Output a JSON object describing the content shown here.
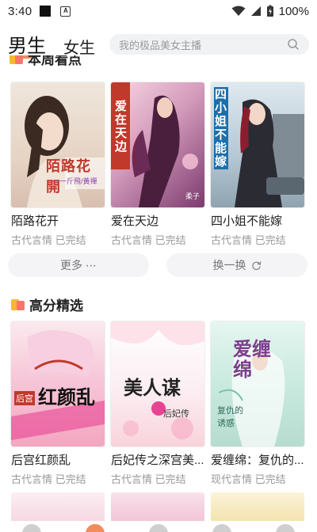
{
  "status_bar": {
    "time": "3:40",
    "battery": "100%"
  },
  "header": {
    "tab_male": "男生",
    "tab_female": "女生",
    "search_placeholder": "我的极品美女主播"
  },
  "section_weekly": {
    "title": "本周看点",
    "books": [
      {
        "title": "陌路花开",
        "meta": "古代言情 已完结",
        "cover_text": "陌路花開",
        "cover_sub": "一一斤飛/黃禪"
      },
      {
        "title": "爱在天边",
        "meta": "古代言情 已完结",
        "cover_text": "爱在天边",
        "cover_sub": "柔子"
      },
      {
        "title": "四小姐不能嫁",
        "meta": "古代言情 已完结",
        "cover_text": "四小姐不能嫁",
        "cover_sub": ""
      }
    ],
    "more_label": "更多 ⋯",
    "refresh_label": "换一换"
  },
  "section_top": {
    "title": "高分精选",
    "books": [
      {
        "title": "后宫红颜乱",
        "meta": "古代言情 已完结",
        "cover_text": "红颜乱",
        "cover_sub": "后宫"
      },
      {
        "title": "后妃传之深宫美...",
        "meta": "古代言情 已完结",
        "cover_text": "美人谋",
        "cover_sub": "后妃传"
      },
      {
        "title": "爱缠绵：复仇的...",
        "meta": "现代言情 已完结",
        "cover_text": "爱缠绵",
        "cover_sub": "复仇的诱惑"
      }
    ]
  },
  "colors": {
    "accent": "#f28c5a",
    "icon_yellow": "#f7b733",
    "icon_red": "#f5776b"
  }
}
